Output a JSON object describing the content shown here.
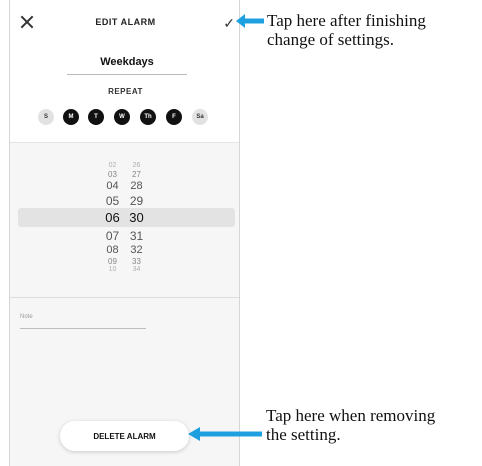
{
  "header": {
    "title": "EDIT ALARM",
    "close_icon": "close-icon",
    "confirm_icon": "check-icon",
    "confirm_glyph": "✓"
  },
  "alarm": {
    "name": "Weekdays"
  },
  "repeat": {
    "label": "REPEAT",
    "days": [
      {
        "label": "S",
        "selected": false
      },
      {
        "label": "M",
        "selected": true
      },
      {
        "label": "T",
        "selected": true
      },
      {
        "label": "W",
        "selected": true
      },
      {
        "label": "Th",
        "selected": true
      },
      {
        "label": "F",
        "selected": true
      },
      {
        "label": "Sa",
        "selected": false
      }
    ]
  },
  "time_picker": {
    "selected_hour": "06",
    "selected_minute": "30",
    "rows": [
      {
        "hour": "02",
        "minute": "26"
      },
      {
        "hour": "03",
        "minute": "27"
      },
      {
        "hour": "04",
        "minute": "28"
      },
      {
        "hour": "05",
        "minute": "29"
      },
      {
        "hour": "06",
        "minute": "30"
      },
      {
        "hour": "07",
        "minute": "31"
      },
      {
        "hour": "08",
        "minute": "32"
      },
      {
        "hour": "09",
        "minute": "33"
      },
      {
        "hour": "10",
        "minute": "34"
      }
    ]
  },
  "note": {
    "placeholder": "Note"
  },
  "delete_button": {
    "label": "DELETE ALARM"
  },
  "annotations": {
    "confirm_callout": "Tap here after finishing change of settings.",
    "confirm_callout_line1": "Tap here after finishing",
    "confirm_callout_line2": "change of settings.",
    "delete_callout_line1": "Tap here when removing",
    "delete_callout_line2": "the setting.",
    "arrow_color": "#1ea0e0"
  }
}
